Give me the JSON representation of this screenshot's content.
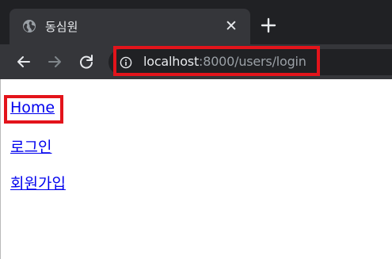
{
  "browser": {
    "tab": {
      "title": "동심원",
      "favicon": "globe-icon",
      "close_label": "✕"
    },
    "new_tab_icon": "plus-icon",
    "toolbar": {
      "back_icon": "arrow-left-icon",
      "forward_icon": "arrow-right-icon",
      "reload_icon": "reload-icon",
      "info_icon": "info-icon"
    },
    "address_bar": {
      "host": "localhost",
      "rest": ":8000/users/login"
    },
    "colors": {
      "tabstrip": "#202124",
      "toolbar": "#35363a",
      "highlight": "#e3141b",
      "link": "#0000ee"
    }
  },
  "page": {
    "links": [
      {
        "label": "Home"
      },
      {
        "label": "로그인"
      },
      {
        "label": "회원가입"
      }
    ]
  }
}
